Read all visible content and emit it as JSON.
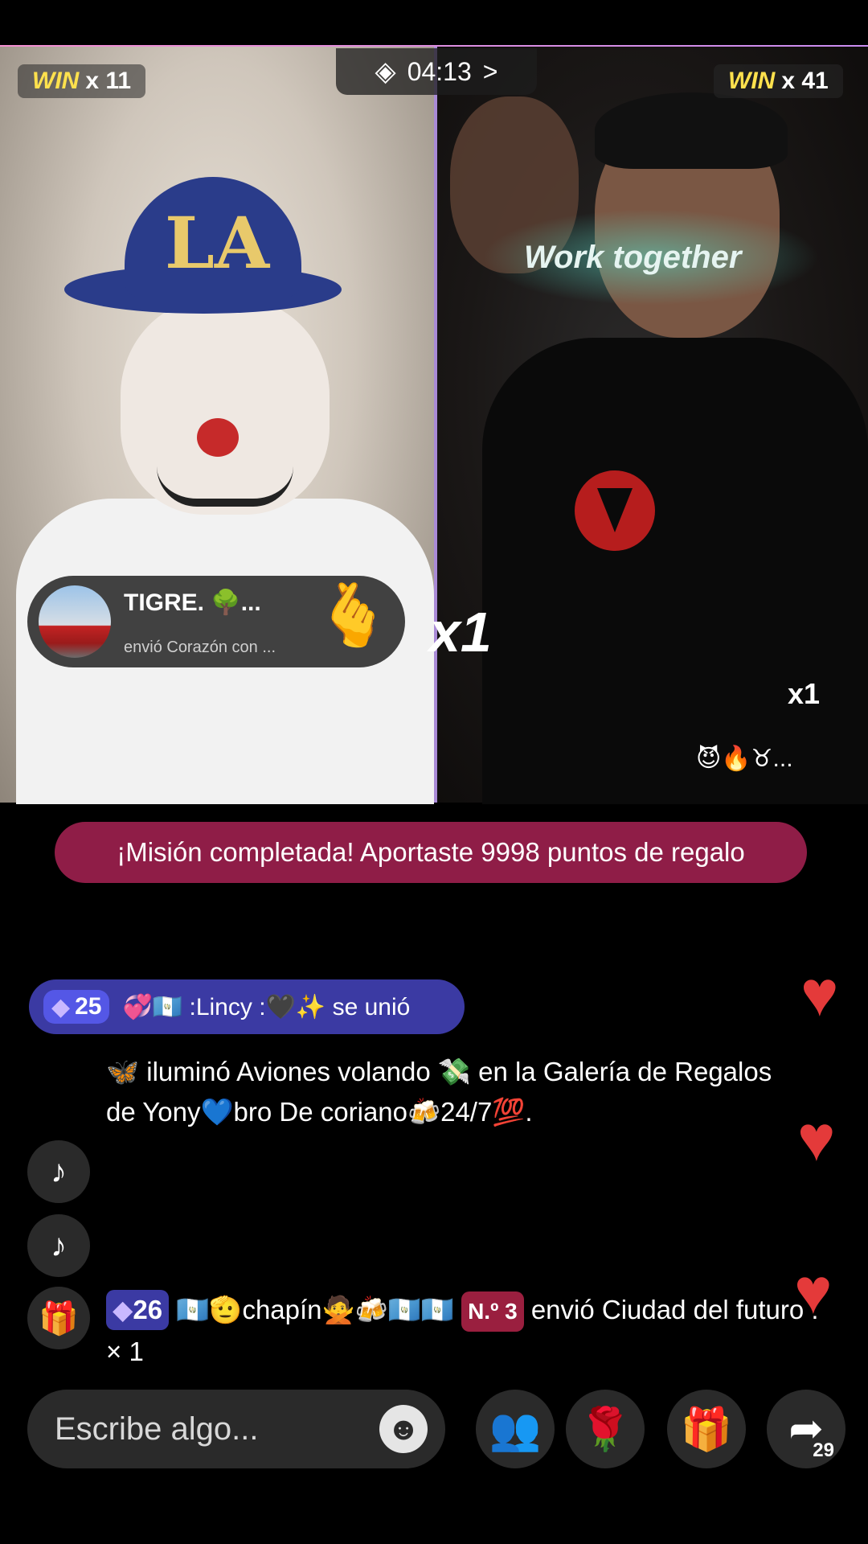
{
  "battle": {
    "left_win_label": "WIN",
    "left_win_count": "x 11",
    "timer": "04:13",
    "timer_arrow": ">",
    "right_win_label": "WIN",
    "right_win_count": "x 41"
  },
  "left_video": {
    "cap_logo": "LA"
  },
  "right_video": {
    "effect_text": "Work together",
    "multiplier": "x1",
    "emoji_row": "😈🔥♉..."
  },
  "gift_notification": {
    "sender": "TIGRE. 🌳...",
    "action": "envió Corazón con ...",
    "gift_emoji": "🫰",
    "multiplier": "x1"
  },
  "mission_banner": "¡Misión completada! Aportaste 9998 puntos de regalo",
  "join_message": {
    "badge_level": "25",
    "text": "💞🇬🇹 :Lincy :🖤✨ se unió"
  },
  "chat": [
    {
      "prefix": "🦋",
      "text": " iluminó Aviones volando 💸 en la Galería de Regalos de Yony💙bro De coriano🍻24/7💯."
    },
    {
      "badge_level": "26",
      "user": " 🇬🇹🫡chapín🙅🍻🇬🇹🇬🇹",
      "rank": "N.º 3",
      "text": " envió Ciudad del futuro .  × 1"
    }
  ],
  "side_icons": {
    "tiktok1": "♪",
    "tiktok2": "♪",
    "gift": "🎁"
  },
  "hearts": [
    "♥",
    "♥",
    "♥"
  ],
  "bottom_bar": {
    "input_placeholder": "Escribe algo...",
    "smiley": "☻",
    "people": "👥",
    "rose": "🌹",
    "gift": "🎁",
    "share": "➦",
    "share_count": "29"
  },
  "colors": {
    "mission_bg": "#8f1d47",
    "join_bg": "#3b3aa3",
    "win_yellow": "#ffe14d",
    "heart_red": "#e43a3a"
  }
}
